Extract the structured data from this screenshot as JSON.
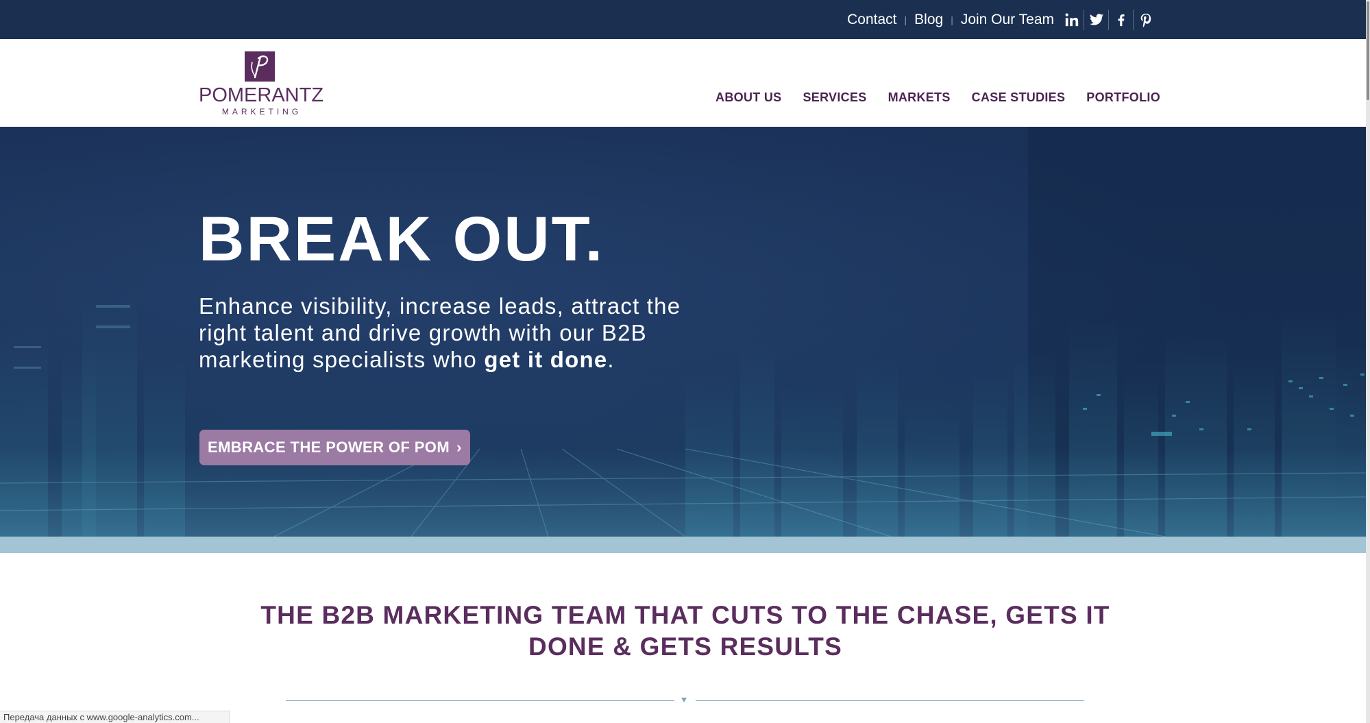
{
  "topbar": {
    "links": [
      "Contact",
      "Blog",
      "Join Our Team"
    ],
    "social": [
      {
        "name": "linkedin-icon"
      },
      {
        "name": "twitter-icon"
      },
      {
        "name": "facebook-icon"
      },
      {
        "name": "pinterest-icon"
      }
    ]
  },
  "logo": {
    "name": "POMERANTZ",
    "sub": "MARKETING"
  },
  "nav": {
    "items": [
      "ABOUT US",
      "SERVICES",
      "MARKETS",
      "CASE STUDIES",
      "PORTFOLIO"
    ]
  },
  "hero": {
    "title": "BREAK OUT.",
    "text_lead": "Enhance visibility, increase leads, attract the right talent and drive growth with our B2B marketing specialists who ",
    "text_bold": "get it done",
    "text_end": ".",
    "cta": "EMBRACE THE POWER OF POM",
    "cta_chevron": "›"
  },
  "section": {
    "tagline": "THE B2B MARKETING TEAM THAT CUTS TO THE CHASE, GETS IT DONE & GETS RESULTS"
  },
  "status": {
    "text": "Передача данных с www.google-analytics.com..."
  },
  "colors": {
    "topbar": "#1b3050",
    "brand_purple": "#5a2d5e",
    "cta": "#9b7aa3",
    "band": "#a3c4d4"
  }
}
